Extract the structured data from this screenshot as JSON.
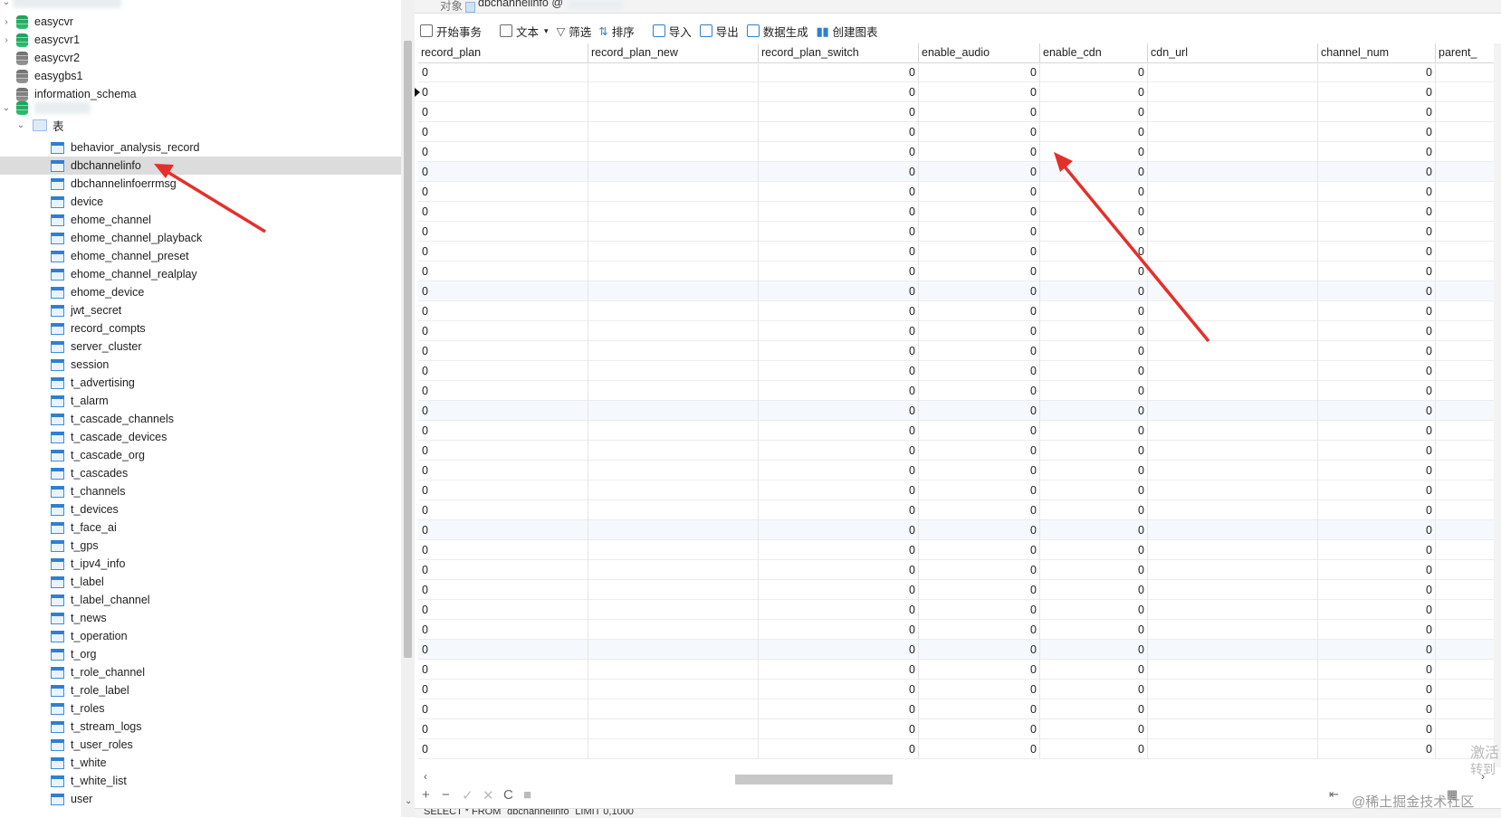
{
  "sidebar": {
    "databases": [
      {
        "name": "easycvr",
        "color": "green",
        "expanded": false
      },
      {
        "name": "easycvr1",
        "color": "green",
        "expanded": false
      },
      {
        "name": "easycvr2",
        "color": "gray",
        "expanded": false
      },
      {
        "name": "easygbs1",
        "color": "gray",
        "expanded": false
      },
      {
        "name": "information_schema",
        "color": "gray",
        "expanded": false
      }
    ],
    "folder_label": "表",
    "tables": [
      "behavior_analysis_record",
      "dbchannelinfo",
      "dbchannelinfoerrmsg",
      "device",
      "ehome_channel",
      "ehome_channel_playback",
      "ehome_channel_preset",
      "ehome_channel_realplay",
      "ehome_device",
      "jwt_secret",
      "record_compts",
      "server_cluster",
      "session",
      "t_advertising",
      "t_alarm",
      "t_cascade_channels",
      "t_cascade_devices",
      "t_cascade_org",
      "t_cascades",
      "t_channels",
      "t_devices",
      "t_face_ai",
      "t_gps",
      "t_ipv4_info",
      "t_label",
      "t_label_channel",
      "t_news",
      "t_operation",
      "t_org",
      "t_role_channel",
      "t_role_label",
      "t_roles",
      "t_stream_logs",
      "t_user_roles",
      "t_white",
      "t_white_list",
      "user"
    ],
    "selected_table": "dbchannelinfo"
  },
  "tabs": {
    "objects": "对象",
    "active": "dbchannelinfo @"
  },
  "toolbar": {
    "begin_transaction": "开始事务",
    "text": "文本",
    "filter": "筛选",
    "sort": "排序",
    "import": "导入",
    "export": "导出",
    "data_generation": "数据生成",
    "create_chart": "创建图表"
  },
  "grid": {
    "columns": [
      "record_plan",
      "record_plan_new",
      "record_plan_switch",
      "enable_audio",
      "enable_cdn",
      "cdn_url",
      "channel_num",
      "parent_"
    ],
    "row_values": [
      "0",
      "",
      "0",
      "0",
      "0",
      "",
      "0"
    ],
    "row_count": 35
  },
  "bottom": {
    "add": "+",
    "remove": "−",
    "apply": "✓",
    "discard": "✕",
    "refresh": "C",
    "stop": "■"
  },
  "status": {
    "sql": "SELECT * FROM `dbchannelinfo` LIMIT 0,1000"
  },
  "watermarks": [
    "激活",
    "转到",
    "@稀土掘金技术社区"
  ]
}
